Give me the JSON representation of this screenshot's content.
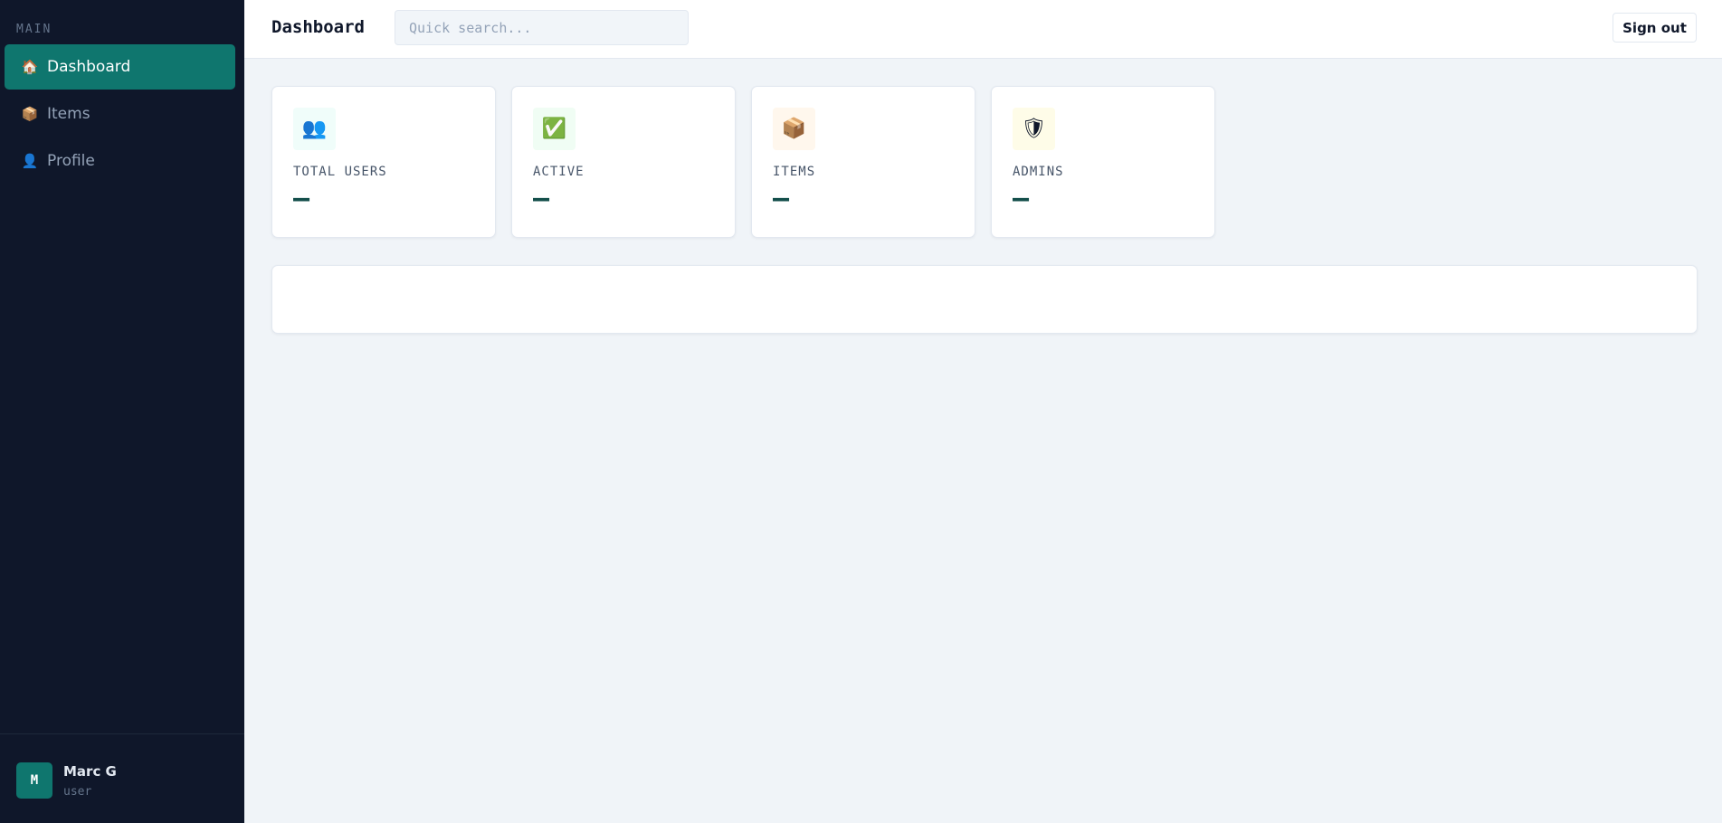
{
  "sidebar": {
    "section_label": "MAIN",
    "items": [
      {
        "label": "Dashboard",
        "icon": "🏠",
        "icon_name": "house-icon",
        "active": true
      },
      {
        "label": "Items",
        "icon": "📦",
        "icon_name": "package-icon",
        "active": false
      },
      {
        "label": "Profile",
        "icon": "👤",
        "icon_name": "user-icon",
        "active": false
      }
    ],
    "user": {
      "initial": "M",
      "name": "Marc G",
      "role": "user"
    }
  },
  "header": {
    "title": "Dashboard",
    "search_placeholder": "Quick search...",
    "signout_label": "Sign out"
  },
  "stats": [
    {
      "label": "TOTAL USERS",
      "value": "—",
      "icon": "👥",
      "icon_name": "users-icon",
      "icon_bg": "#f0fdfa"
    },
    {
      "label": "ACTIVE",
      "value": "—",
      "icon": "✅",
      "icon_name": "check-icon",
      "icon_bg": "#f0fdf4"
    },
    {
      "label": "ITEMS",
      "value": "—",
      "icon": "📦",
      "icon_name": "package-icon",
      "icon_bg": "#fff7ed"
    },
    {
      "label": "ADMINS",
      "value": "—",
      "icon": "🛡",
      "icon_name": "shield-icon",
      "icon_bg": "#fefce8"
    }
  ],
  "colors": {
    "sidebar_bg": "#0f172a",
    "accent": "#0f766e",
    "page_bg": "#f0f4f8",
    "value_text": "#134e4a"
  }
}
